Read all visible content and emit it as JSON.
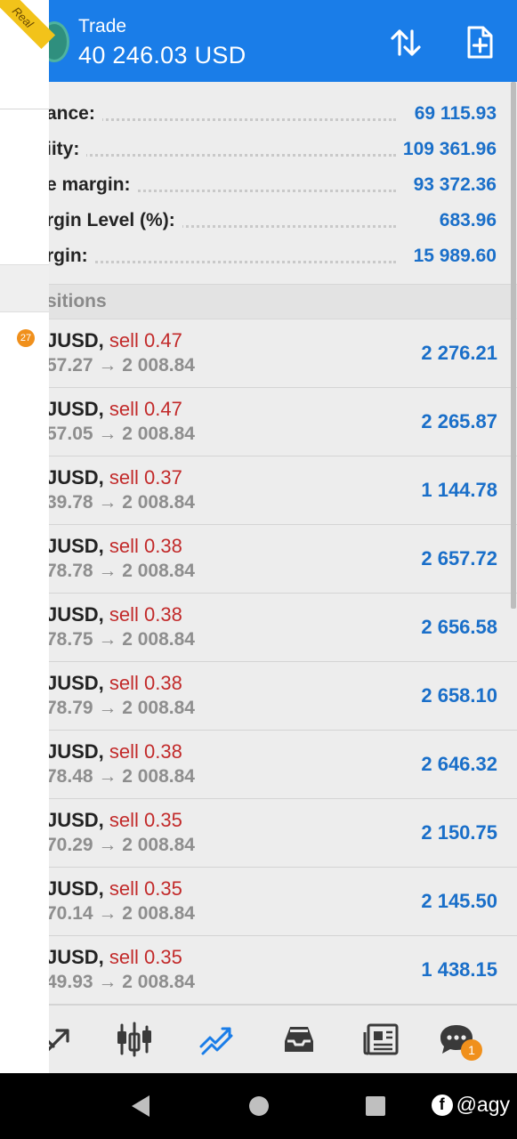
{
  "header": {
    "title": "Trade",
    "subtitle": "40 246.03 USD"
  },
  "summary": [
    {
      "label": "ance:",
      "value": "69 115.93"
    },
    {
      "label": "iity:",
      "value": "109 361.96"
    },
    {
      "label": "e margin:",
      "value": "93 372.36"
    },
    {
      "label": "rgin Level (%):",
      "value": "683.96"
    },
    {
      "label": "rgin:",
      "value": "15 989.60"
    }
  ],
  "positions_header": "sitions",
  "positions": [
    {
      "symbol": "JUSD,",
      "side": "sell 0.47",
      "prices": "57.27 → 2 008.84",
      "profit": "2 276.21"
    },
    {
      "symbol": "JUSD,",
      "side": "sell 0.47",
      "prices": "57.05 → 2 008.84",
      "profit": "2 265.87"
    },
    {
      "symbol": "JUSD,",
      "side": "sell 0.37",
      "prices": "39.78 → 2 008.84",
      "profit": "1 144.78"
    },
    {
      "symbol": "JUSD,",
      "side": "sell 0.38",
      "prices": "78.78 → 2 008.84",
      "profit": "2 657.72"
    },
    {
      "symbol": "JUSD,",
      "side": "sell 0.38",
      "prices": "78.75 → 2 008.84",
      "profit": "2 656.58"
    },
    {
      "symbol": "JUSD,",
      "side": "sell 0.38",
      "prices": "78.79 → 2 008.84",
      "profit": "2 658.10"
    },
    {
      "symbol": "JUSD,",
      "side": "sell 0.38",
      "prices": "78.48 → 2 008.84",
      "profit": "2 646.32"
    },
    {
      "symbol": "JUSD,",
      "side": "sell 0.35",
      "prices": "70.29 → 2 008.84",
      "profit": "2 150.75"
    },
    {
      "symbol": "JUSD,",
      "side": "sell 0.35",
      "prices": "70.14 → 2 008.84",
      "profit": "2 145.50"
    },
    {
      "symbol": "JUSD,",
      "side": "sell 0.35",
      "prices": "49.93 → 2 008.84",
      "profit": "1 438.15"
    }
  ],
  "nav": {
    "items": [
      "quotes-icon",
      "chart-icon",
      "trade-icon",
      "history-icon",
      "news-icon",
      "messages-icon"
    ],
    "active": "trade-icon",
    "messages_badge": "1"
  },
  "overlay": {
    "ribbon": "Real",
    "count_badge": "27"
  },
  "system_bar": {
    "handle": "@agy"
  },
  "colors": {
    "header": "#1a7de8",
    "value_blue": "#1a6fc9",
    "sell_red": "#c22a2a",
    "badge_orange": "#f0901c"
  }
}
